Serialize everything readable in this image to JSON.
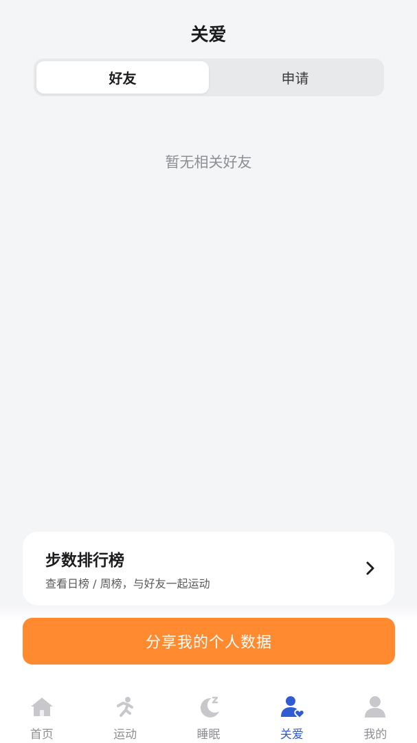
{
  "header": {
    "title": "关爱"
  },
  "segment": {
    "tabs": [
      "好友",
      "申请"
    ],
    "active_index": 0
  },
  "empty_state": {
    "text": "暂无相关好友"
  },
  "rank_card": {
    "title": "步数排行榜",
    "subtitle": "查看日榜 / 周榜，与好友一起运动"
  },
  "share_button": {
    "label": "分享我的个人数据",
    "color": "#ff8a2f"
  },
  "tabbar": {
    "items": [
      {
        "label": "首页",
        "icon": "home-icon"
      },
      {
        "label": "运动",
        "icon": "running-icon"
      },
      {
        "label": "睡眠",
        "icon": "sleep-moon-icon"
      },
      {
        "label": "关爱",
        "icon": "care-people-icon"
      },
      {
        "label": "我的",
        "icon": "profile-icon"
      }
    ],
    "active_index": 3,
    "active_color": "#2f5bd3",
    "inactive_color": "#c7c7cc"
  }
}
